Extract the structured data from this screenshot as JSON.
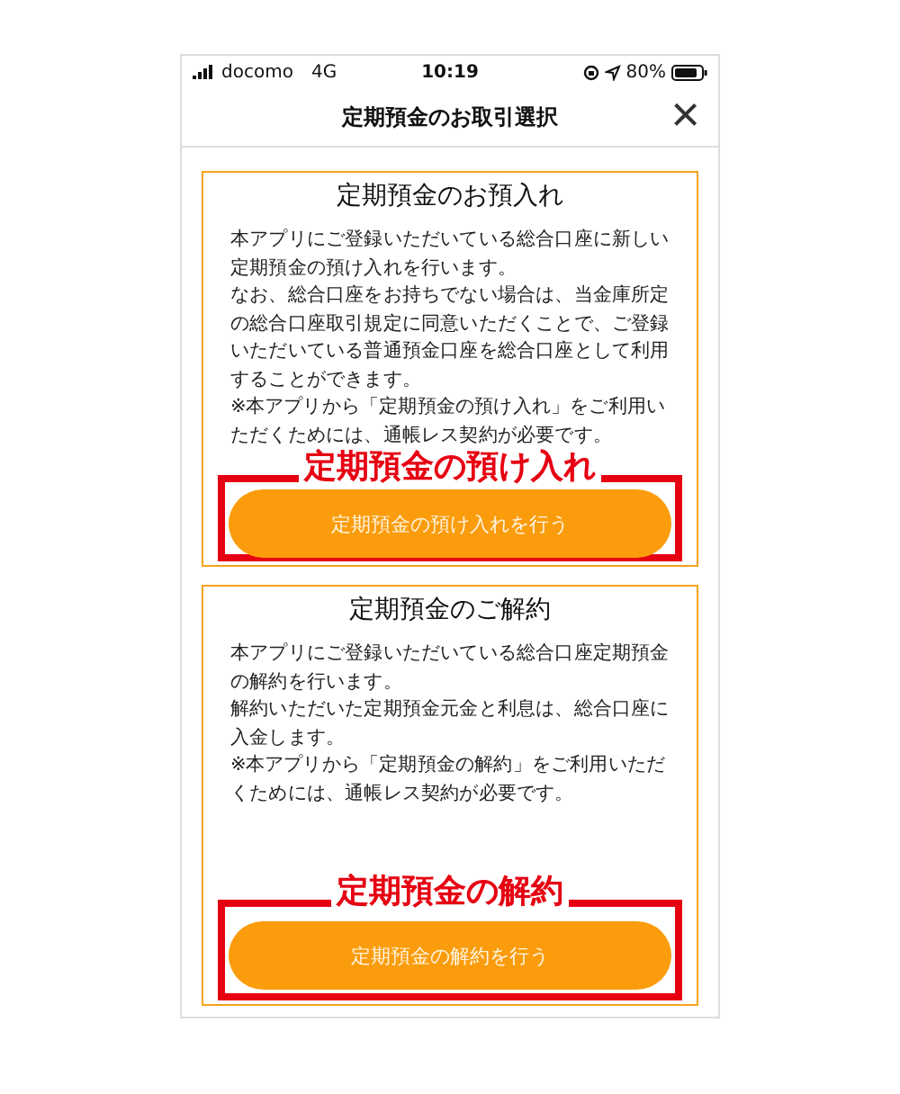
{
  "status_bar": {
    "carrier": "docomo",
    "network": "4G",
    "time": "10:19",
    "battery": "80%"
  },
  "header": {
    "title": "定期預金のお取引選択",
    "close": "×"
  },
  "cards": [
    {
      "title": "定期預金のお預入れ",
      "body": [
        "本アプリにご登録いただいている総合口座に新しい定期預金の預け入れを行います。",
        "なお、総合口座をお持ちでない場合は、当金庫所定の総合口座取引規定に同意いただくことで、ご登録いただいている普通預金口座を総合口座として利用することができます。",
        "※本アプリから「定期預金の預け入れ」をご利用いただくためには、通帳レス契約が必要です。"
      ],
      "button": "定期預金の預け入れを行う",
      "annotation": "定期預金の預け入れ"
    },
    {
      "title": "定期預金のご解約",
      "body": [
        "本アプリにご登録いただいている総合口座定期預金の解約を行います。",
        "解約いただいた定期預金元金と利息は、総合口座に入金します。",
        "※本アプリから「定期預金の解約」をご利用いただくためには、通帳レス契約が必要です。"
      ],
      "button": "定期預金の解約を行う",
      "annotation": "定期預金の解約"
    }
  ]
}
